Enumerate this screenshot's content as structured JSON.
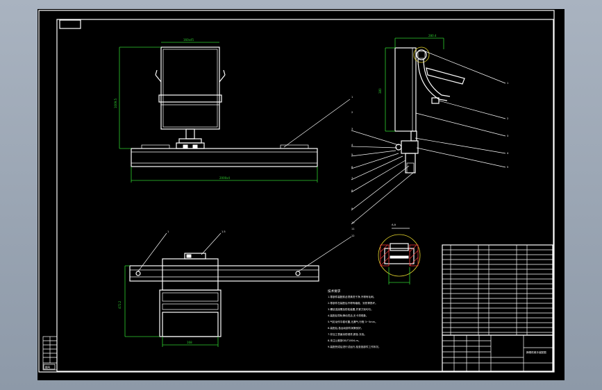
{
  "drawing": {
    "dimensions": {
      "front_top_width": "160x45",
      "front_height": "1009.5",
      "front_rail_length": "2000x4",
      "side_top_width": "280.4",
      "side_height": "380",
      "plan_height": "472.2",
      "plan_width": "168",
      "section_label": "A-A"
    },
    "side_callouts": [
      "1",
      "2",
      "3",
      "4",
      "5",
      "6",
      "7",
      "8",
      "9",
      "10",
      "11",
      "12",
      "13",
      "14",
      "15",
      "16"
    ],
    "left_callouts": [
      "1",
      "2",
      "3",
      "4",
      "5",
      "6",
      "7",
      "8",
      "9",
      "10",
      "11",
      "12"
    ],
    "plan_callouts": [
      "1",
      "1.5"
    ],
    "notes_title": "技术要求",
    "notes": [
      "1.零部件装配前必须清洗干净,不得有毛刺。",
      "2.零部件在装配后不得有磕碰、划伤等损坏。",
      "3.螺纹连接需加防松装置,拧紧力矩均匀。",
      "4.装配后导轨滑动灵活,无卡滞现象。",
      "5.气缸动作平稳可靠,无漏气,行程 3~5mm。",
      "6.装配后,各运动部件润滑良好。",
      "7.非加工表面涂防锈漆,颜色 灰色。",
      "8.未注公差按GB/T1804-m。",
      "9.装配完成后进行试运行,检查各部件工作状况。"
    ],
    "title_block_name": "摘棉机械手装配图",
    "corner_label": "图号"
  }
}
